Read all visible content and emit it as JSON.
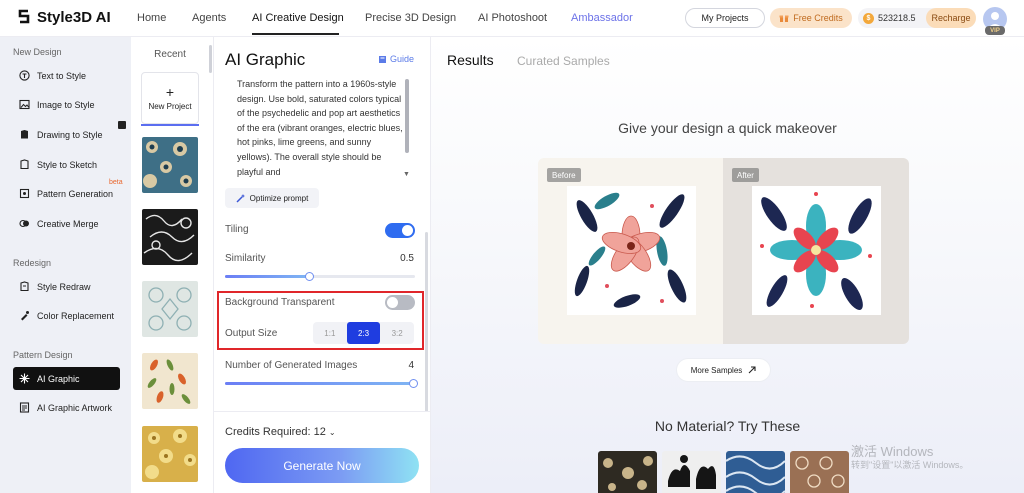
{
  "header": {
    "logo": "Style3D AI",
    "nav": [
      "Home",
      "Agents",
      "AI Creative Design",
      "Precise 3D Design",
      "AI Photoshoot",
      "Ambassador"
    ],
    "my_projects": "My Projects",
    "free_credits": "Free Credits",
    "coin_balance": "523218.5",
    "recharge": "Recharge",
    "vip": "VIP"
  },
  "sidebar": {
    "sections": {
      "new_design": "New Design",
      "redesign": "Redesign",
      "pattern_design": "Pattern Design"
    },
    "items": [
      {
        "label": "Text to Style",
        "icon": "text-style-icon"
      },
      {
        "label": "Image to Style",
        "icon": "image-style-icon"
      },
      {
        "label": "Drawing to Style",
        "icon": "drawing-style-icon"
      },
      {
        "label": "Style to Sketch",
        "icon": "sketch-icon"
      },
      {
        "label": "Pattern Generation",
        "icon": "pattern-icon",
        "badge": "beta"
      },
      {
        "label": "Creative Merge",
        "icon": "merge-icon"
      },
      {
        "label": "Style Redraw",
        "icon": "redraw-icon"
      },
      {
        "label": "Color Replacement",
        "icon": "color-replace-icon"
      },
      {
        "label": "AI Graphic",
        "icon": "ai-graphic-icon",
        "active": true
      },
      {
        "label": "AI Graphic Artwork",
        "icon": "artwork-icon"
      }
    ]
  },
  "recent": {
    "title": "Recent",
    "new_project": "New Project"
  },
  "panel": {
    "title": "AI Graphic",
    "guide": "Guide",
    "prompt": "Transform the pattern into a 1960s-style design. Use bold, saturated colors typical of the psychedelic and pop art aesthetics of the era (vibrant oranges, electric blues, hot pinks, lime greens, and sunny yellows). The overall style should be playful and",
    "optimize": "Optimize prompt",
    "tiling_label": "Tiling",
    "tiling_on": true,
    "similarity_label": "Similarity",
    "similarity_value": "0.5",
    "similarity": 0.5,
    "bg_transparent_label": "Background Transparent",
    "bg_transparent_on": false,
    "output_size_label": "Output Size",
    "output_sizes": [
      "1:1",
      "2:3",
      "3:2"
    ],
    "output_size_selected": "2:3",
    "num_images_label": "Number of Generated Images",
    "num_images_value": "4",
    "credits_required": "Credits Required: 12",
    "generate": "Generate Now"
  },
  "main": {
    "tabs": [
      "Results",
      "Curated Samples"
    ],
    "makeover_title": "Give your design a quick makeover",
    "before_label": "Before",
    "after_label": "After",
    "more_samples": "More Samples",
    "no_material": "No Material? Try These"
  },
  "watermark": {
    "line1": "激活 Windows",
    "line2": "转到\"设置\"以激活 Windows。"
  }
}
